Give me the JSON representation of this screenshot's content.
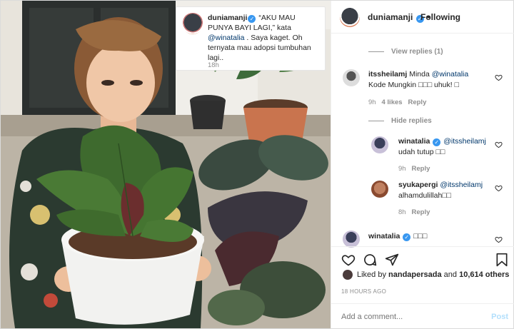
{
  "post": {
    "author": "duniamanji",
    "follow_status": "Following",
    "separator": "•"
  },
  "caption": {
    "username": "duniamanji",
    "text_part1": "“AKU MAU PUNYA BAYI LAGI,” kata ",
    "mention": "@winatalia",
    "text_part2": " . Saya kaget. Oh ternyata mau adopsi tumbuhan lagi..",
    "time": "18h"
  },
  "comments": {
    "view_replies": "View replies (1)",
    "c1": {
      "username": "itssheilamj",
      "text_part1": " Minda ",
      "mention": "@winatalia",
      "text_part2": "Kode Mungkin □□□ uhuk! □",
      "time": "9h",
      "likes": "4 likes",
      "reply": "Reply"
    },
    "hide_replies": "Hide replies",
    "r1": {
      "username": "winatalia",
      "mention": "@itssheilamj",
      "text": "udah tutup □□",
      "time": "9h",
      "reply": "Reply"
    },
    "r2": {
      "username": "syukapergi",
      "mention": "@itssheilamj",
      "text": "alhamdulillah□□",
      "time": "8h",
      "reply": "Reply"
    },
    "c2": {
      "username": "winatalia",
      "text": "□□□"
    }
  },
  "actions": {
    "liked_by_prefix": "Liked by ",
    "liked_by_user": "nandapersada",
    "liked_by_suffix": " and ",
    "liked_by_count": "10,614 others",
    "time_ago": "18 HOURS AGO"
  },
  "add_comment": {
    "placeholder": "Add a comment...",
    "post_label": "Post"
  },
  "colors": {
    "verified": "#3897f0",
    "mention": "#00376b",
    "post_disabled": "#b2dffc",
    "muted": "#8e8e8e"
  },
  "icons": [
    "verified-badge-icon",
    "heart-icon",
    "comment-icon",
    "share-icon",
    "bookmark-icon",
    "small-heart-icon"
  ]
}
